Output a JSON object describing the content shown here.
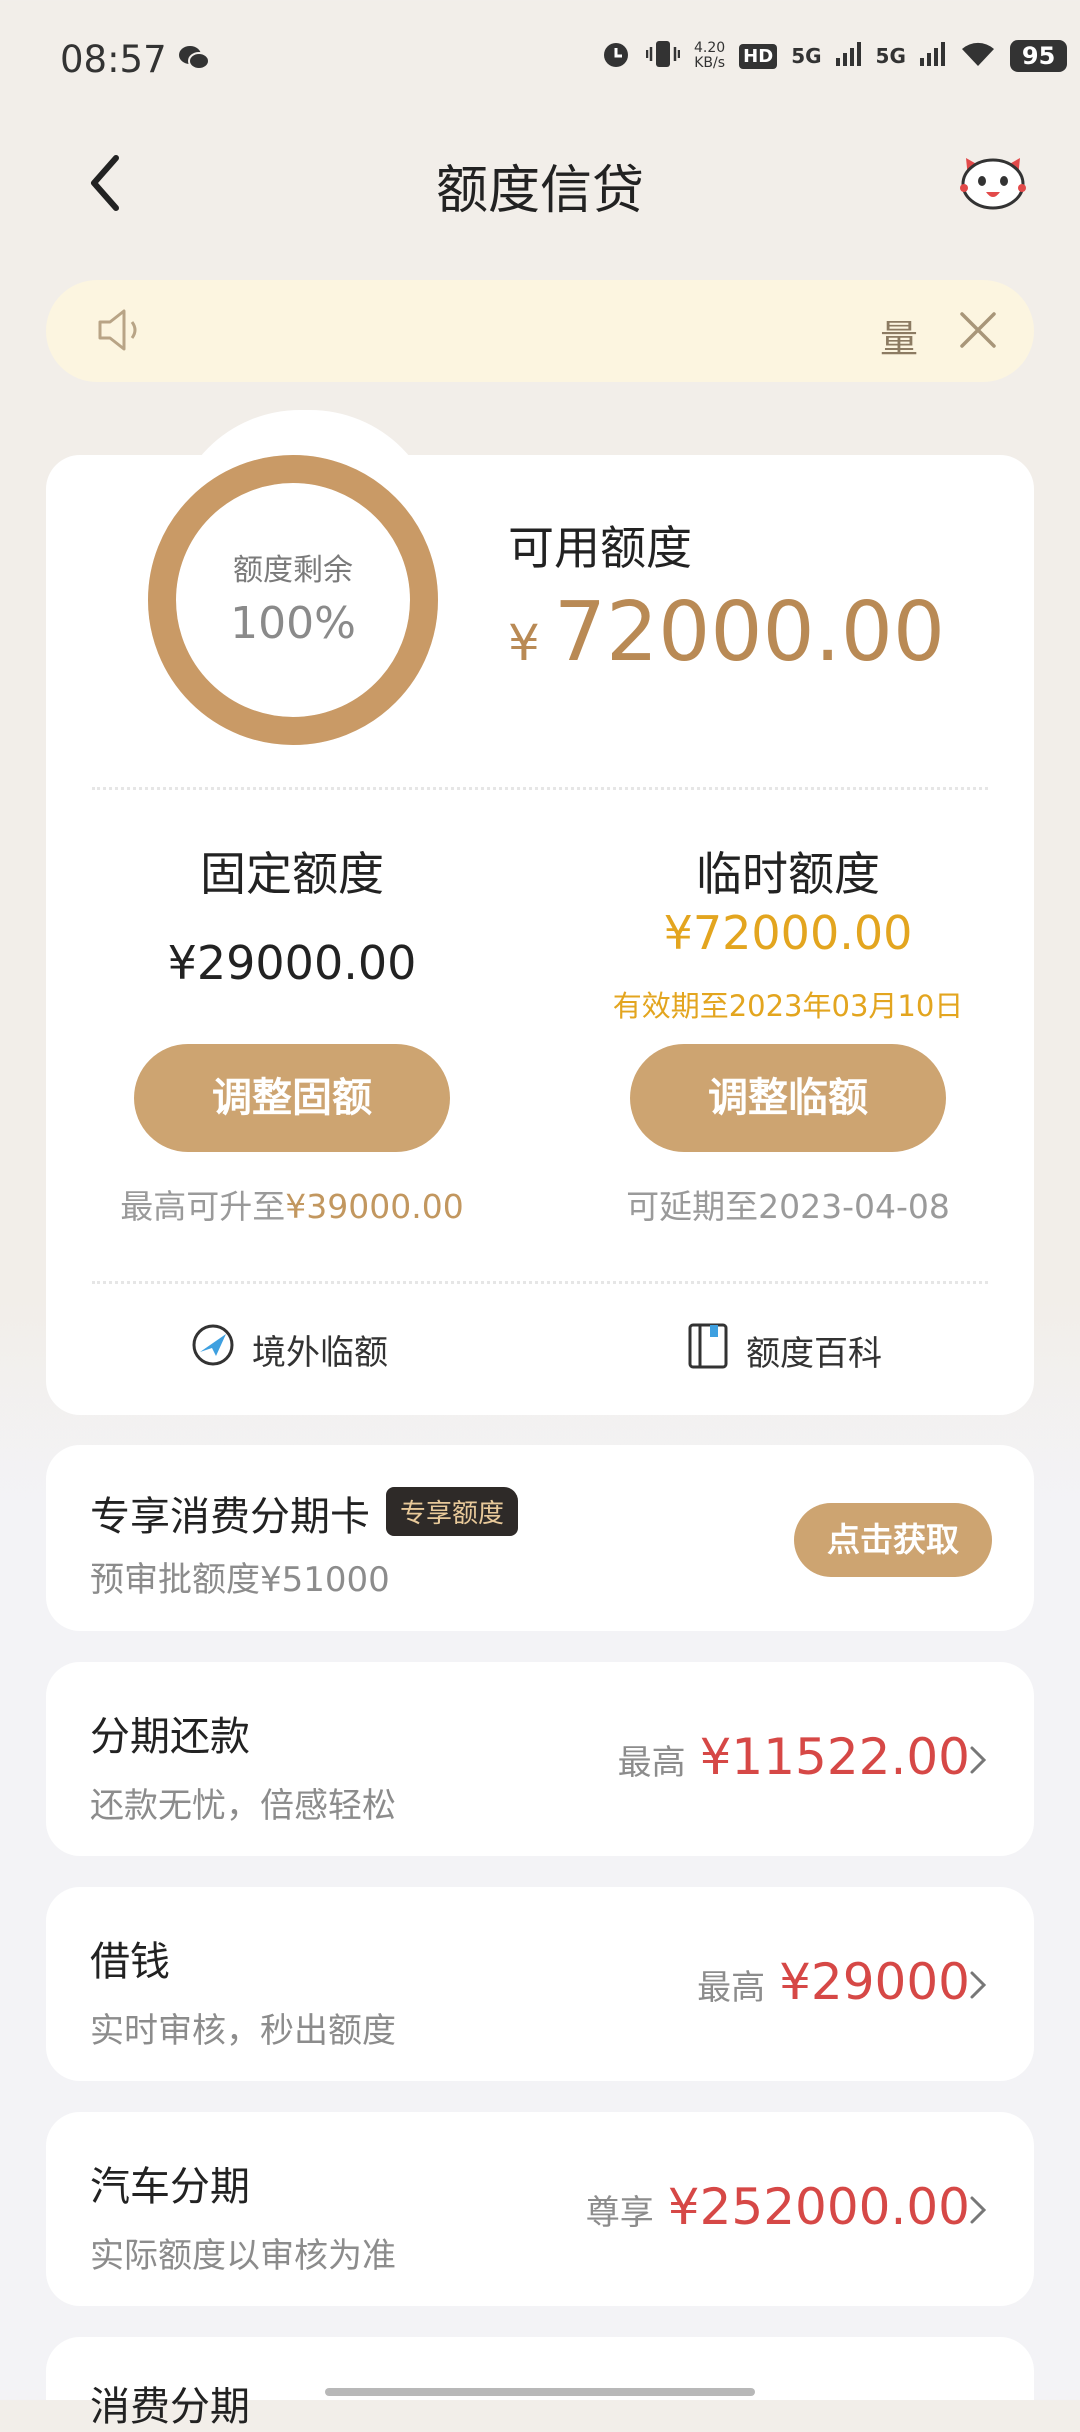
{
  "status_bar": {
    "time": "08:57",
    "net_speed": "4.20",
    "net_unit": "KB/s",
    "signal_1": "5G",
    "signal_2": "5G",
    "battery": "95"
  },
  "header": {
    "title": "额度信贷"
  },
  "notice": {
    "text": "量"
  },
  "credit": {
    "ring_label": "额度剩余",
    "ring_percent": "100%",
    "ring_fraction": 1.0,
    "available_label": "可用额度",
    "available_currency": "¥",
    "available_amount": "72000.00",
    "fixed": {
      "title": "固定额度",
      "amount": "¥29000.00",
      "button": "调整固额",
      "note_prefix": "最高可升至",
      "note_value": "¥39000.00"
    },
    "temporary": {
      "title": "临时额度",
      "amount": "¥72000.00",
      "validity": "有效期至2023年03月10日",
      "button": "调整临额",
      "note": "可延期至2023-04-08"
    },
    "links": {
      "overseas": "境外临额",
      "wiki": "额度百科"
    }
  },
  "promo": {
    "title": "专享消费分期卡",
    "tag": "专享额度",
    "subtitle": "预审批额度¥51000",
    "button": "点击获取"
  },
  "products": [
    {
      "title": "分期还款",
      "subtitle": "还款无忧，倍感轻松",
      "prefix": "最高",
      "amount": "¥11522.00"
    },
    {
      "title": "借钱",
      "subtitle": "实时审核，秒出额度",
      "prefix": "最高",
      "amount": "¥29000"
    },
    {
      "title": "汽车分期",
      "subtitle": "实际额度以审核为准",
      "prefix": "尊享",
      "amount": "¥252000.00"
    },
    {
      "title": "消费分期"
    }
  ],
  "colors": {
    "accent": "#cda471",
    "amount_gold": "#b98a55",
    "temp_gold": "#e3a51f",
    "red": "#d64846"
  }
}
